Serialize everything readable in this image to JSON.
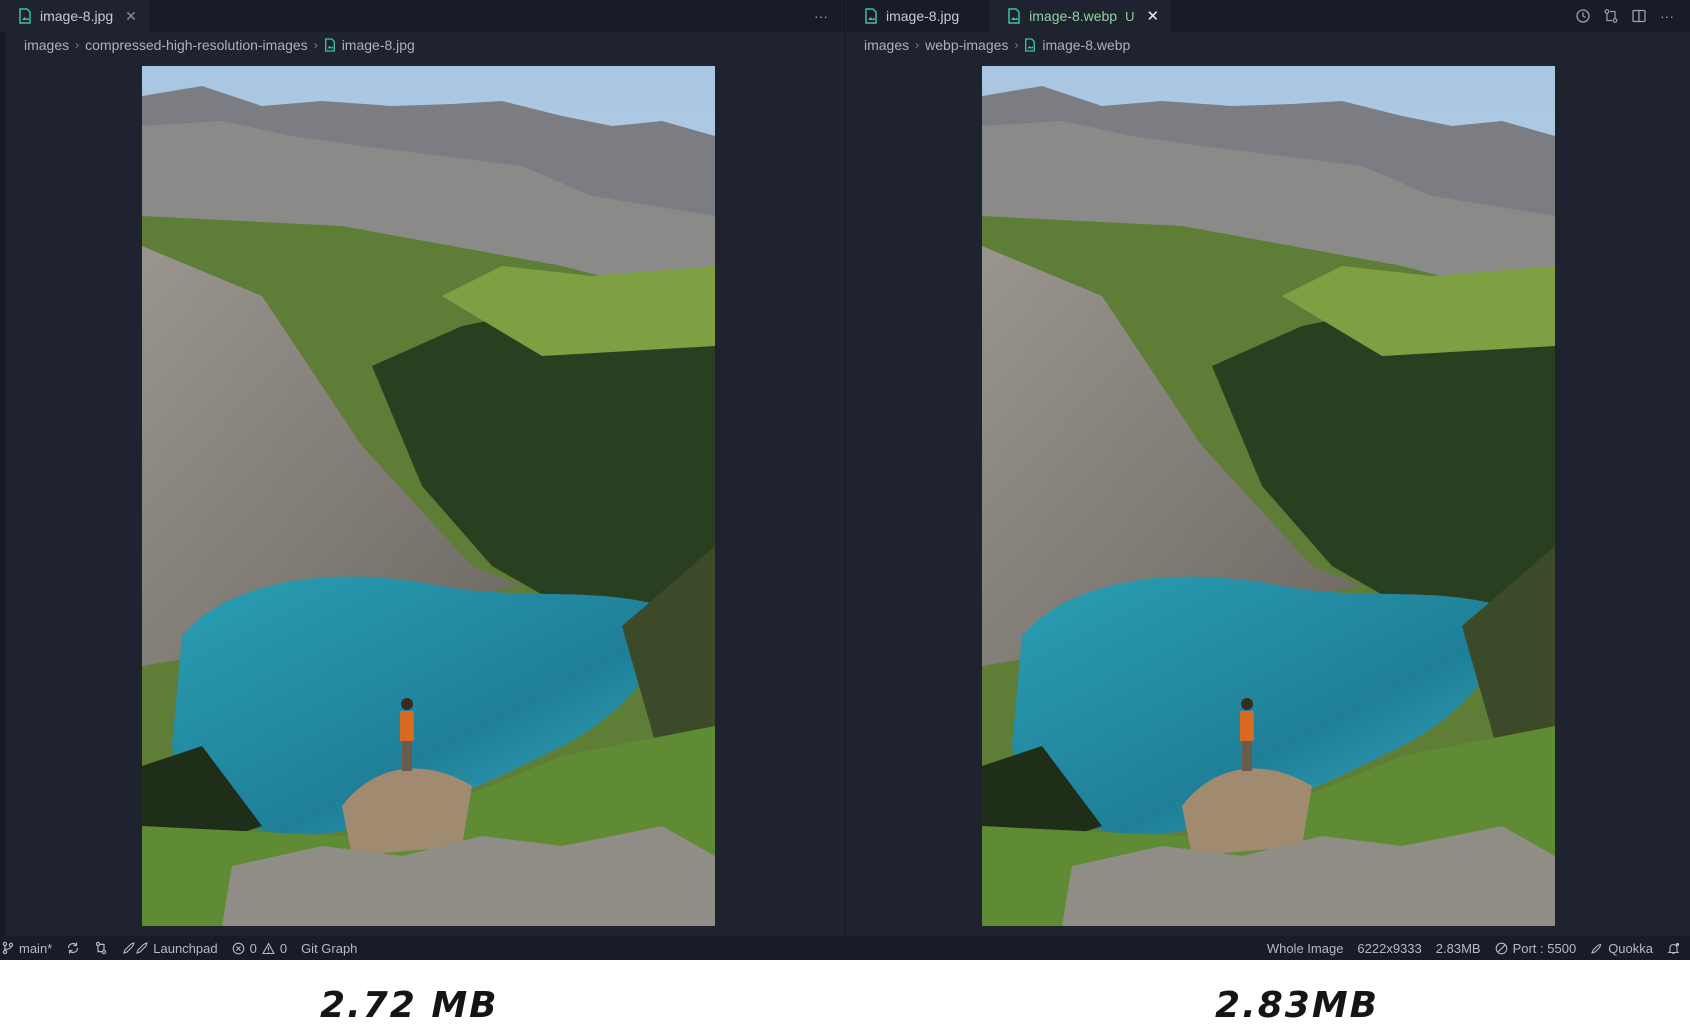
{
  "left_pane": {
    "tabs": [
      {
        "label": "image-8.jpg"
      }
    ],
    "more_label": "···",
    "breadcrumb": [
      "images",
      "compressed-high-resolution-images",
      "image-8.jpg"
    ]
  },
  "right_pane": {
    "tabs": [
      {
        "label": "image-8.jpg"
      },
      {
        "label": "image-8.webp",
        "status": "U"
      }
    ],
    "more_label": "···",
    "breadcrumb": [
      "images",
      "webp-images",
      "image-8.webp"
    ]
  },
  "statusbar": {
    "branch": "main*",
    "launchpad": "Launchpad",
    "errors": "0",
    "warnings": "0",
    "git_graph": "Git Graph",
    "whole_image": "Whole Image",
    "dimensions": "6222x9333",
    "file_size": "2.83MB",
    "port": "Port : 5500",
    "quokka": "Quokka"
  },
  "captions": {
    "left": "2.72 MB",
    "right": "2.83MB"
  },
  "colors": {
    "editor_bg": "#1f2330",
    "tab_bar_bg": "#191c27",
    "modified_green": "#8fd2a0",
    "file_icon_teal": "#3fbfa6"
  }
}
